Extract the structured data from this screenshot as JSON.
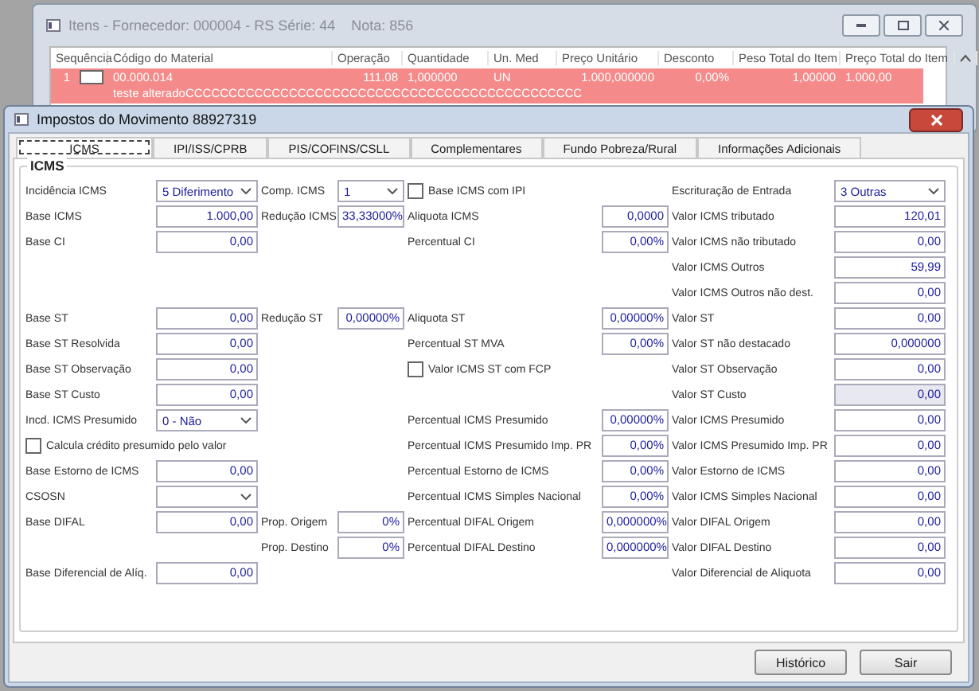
{
  "back_window": {
    "title": "Itens - Fornecedor: 000004 - RS Série: 44    Nota: 856",
    "columns": [
      "Sequência",
      "Código do Material",
      "Operação",
      "Quantidade",
      "Un. Med",
      "Preço Unitário",
      "Desconto",
      "Peso Total do Item",
      "Preço Total do Item"
    ],
    "rows": [
      {
        "selected": true,
        "checked": false,
        "cells": [
          "1",
          "00.000.014",
          "111.08",
          "1,000000",
          "UN",
          "1.000,000000",
          "0,00%",
          "1,00000",
          "1.000,00"
        ],
        "note": "teste alteradoCCCCCCCCCCCCCCCCCCCCCCCCCCCCCCCCCCCCCCCCCCCCCC"
      }
    ]
  },
  "dialog": {
    "title": "Impostos do Movimento 88927319",
    "tabs": [
      {
        "label": "ICMS",
        "selected": true
      },
      {
        "label": "IPI/ISS/CPRB",
        "selected": false
      },
      {
        "label": "PIS/COFINS/CSLL",
        "selected": false
      },
      {
        "label": "Complementares",
        "selected": false
      },
      {
        "label": "Fundo Pobreza/Rural",
        "selected": false
      },
      {
        "label": "Informações Adicionais",
        "selected": false
      }
    ],
    "group_title": "ICMS",
    "rows": [
      [
        {
          "kind": "select",
          "label": "Incidência ICMS",
          "value": "5 Diferimento"
        },
        {
          "kind": "select",
          "label": "Comp. ICMS",
          "value": "1"
        },
        {
          "kind": "checkbox",
          "label": "Base ICMS com IPI",
          "checked": false
        },
        {
          "kind": "select",
          "label": "Escrituração de Entrada",
          "value": "3 Outras"
        }
      ],
      [
        {
          "kind": "field",
          "label": "Base ICMS",
          "value": "1.000,00"
        },
        {
          "kind": "field",
          "label": "Redução ICMS",
          "value": "33,33000%"
        },
        {
          "kind": "field",
          "label": "Aliquota ICMS",
          "value": "0,0000"
        },
        {
          "kind": "field",
          "label": "Valor ICMS tributado",
          "value": "120,01"
        }
      ],
      [
        {
          "kind": "field",
          "label": "Base CI",
          "value": "0,00"
        },
        {
          "kind": "empty"
        },
        {
          "kind": "field",
          "label": "Percentual CI",
          "value": "0,00%"
        },
        {
          "kind": "field",
          "label": "Valor ICMS não tributado",
          "value": "0,00"
        }
      ],
      [
        {
          "kind": "empty"
        },
        {
          "kind": "empty"
        },
        {
          "kind": "empty"
        },
        {
          "kind": "field",
          "label": "Valor ICMS Outros",
          "value": "59,99"
        }
      ],
      [
        {
          "kind": "empty"
        },
        {
          "kind": "empty"
        },
        {
          "kind": "empty"
        },
        {
          "kind": "field",
          "label": "Valor ICMS Outros não dest.",
          "value": "0,00"
        }
      ],
      [
        {
          "kind": "field",
          "label": "Base ST",
          "value": "0,00"
        },
        {
          "kind": "field",
          "label": "Redução ST",
          "value": "0,00000%"
        },
        {
          "kind": "field",
          "label": "Aliquota ST",
          "value": "0,00000%"
        },
        {
          "kind": "field",
          "label": "Valor ST",
          "value": "0,00"
        }
      ],
      [
        {
          "kind": "field",
          "label": "Base ST Resolvida",
          "value": "0,00"
        },
        {
          "kind": "empty"
        },
        {
          "kind": "field",
          "label": "Percentual ST MVA",
          "value": "0,00%"
        },
        {
          "kind": "field",
          "label": "Valor ST não destacado",
          "value": "0,000000"
        }
      ],
      [
        {
          "kind": "field",
          "label": "Base ST Observação",
          "value": "0,00"
        },
        {
          "kind": "empty"
        },
        {
          "kind": "checkbox",
          "label": "Valor ICMS ST com FCP",
          "checked": false
        },
        {
          "kind": "field",
          "label": "Valor ST Observação",
          "value": "0,00"
        }
      ],
      [
        {
          "kind": "field",
          "label": "Base ST Custo",
          "value": "0,00"
        },
        {
          "kind": "empty"
        },
        {
          "kind": "empty"
        },
        {
          "kind": "locked",
          "label": "Valor ST Custo",
          "value": "0,00"
        }
      ],
      [
        {
          "kind": "select",
          "label": "Incd. ICMS Presumido",
          "value": "0 - Não"
        },
        {
          "kind": "empty"
        },
        {
          "kind": "field",
          "label": "Percentual ICMS Presumido",
          "value": "0,00000%"
        },
        {
          "kind": "field",
          "label": "Valor ICMS Presumido",
          "value": "0,00"
        }
      ],
      [
        {
          "kind": "checkbox",
          "label": "Calcula crédito presumido pelo valor",
          "checked": false
        },
        {
          "kind": "empty"
        },
        {
          "kind": "field",
          "label": "Percentual ICMS Presumido Imp. PR",
          "value": "0,00%"
        },
        {
          "kind": "field",
          "label": "Valor ICMS Presumido Imp. PR",
          "value": "0,00"
        }
      ],
      [
        {
          "kind": "field",
          "label": "Base Estorno de ICMS",
          "value": "0,00"
        },
        {
          "kind": "empty"
        },
        {
          "kind": "field",
          "label": "Percentual Estorno de ICMS",
          "value": "0,00%"
        },
        {
          "kind": "field",
          "label": "Valor Estorno de ICMS",
          "value": "0,00"
        }
      ],
      [
        {
          "kind": "select",
          "label": "CSOSN"
        },
        {
          "kind": "empty"
        },
        {
          "kind": "field",
          "label": "Percentual ICMS Simples Nacional",
          "value": "0,00%"
        },
        {
          "kind": "field",
          "label": "Valor ICMS Simples Nacional",
          "value": "0,00"
        }
      ],
      [
        {
          "kind": "field",
          "label": "Base DIFAL",
          "value": "0,00"
        },
        {
          "kind": "field",
          "label": "Prop. Origem",
          "value": "0%"
        },
        {
          "kind": "field",
          "label": "Percentual DIFAL Origem",
          "value": "0,000000%"
        },
        {
          "kind": "field",
          "label": "Valor DIFAL Origem",
          "value": "0,00"
        }
      ],
      [
        {
          "kind": "empty"
        },
        {
          "kind": "field",
          "label": "Prop. Destino",
          "value": "0%"
        },
        {
          "kind": "field",
          "label": "Percentual DIFAL Destino",
          "value": "0,000000%"
        },
        {
          "kind": "field",
          "label": "Valor DIFAL Destino",
          "value": "0,00"
        }
      ],
      [
        {
          "kind": "field",
          "label": "Base Diferencial de Alíq.",
          "value": "0,00"
        },
        {
          "kind": "empty"
        },
        {
          "kind": "empty"
        },
        {
          "kind": "field",
          "label": "Valor Diferencial de Aliquota",
          "value": "0,00"
        }
      ]
    ],
    "buttons": [
      "Histórico",
      "Sair"
    ]
  }
}
